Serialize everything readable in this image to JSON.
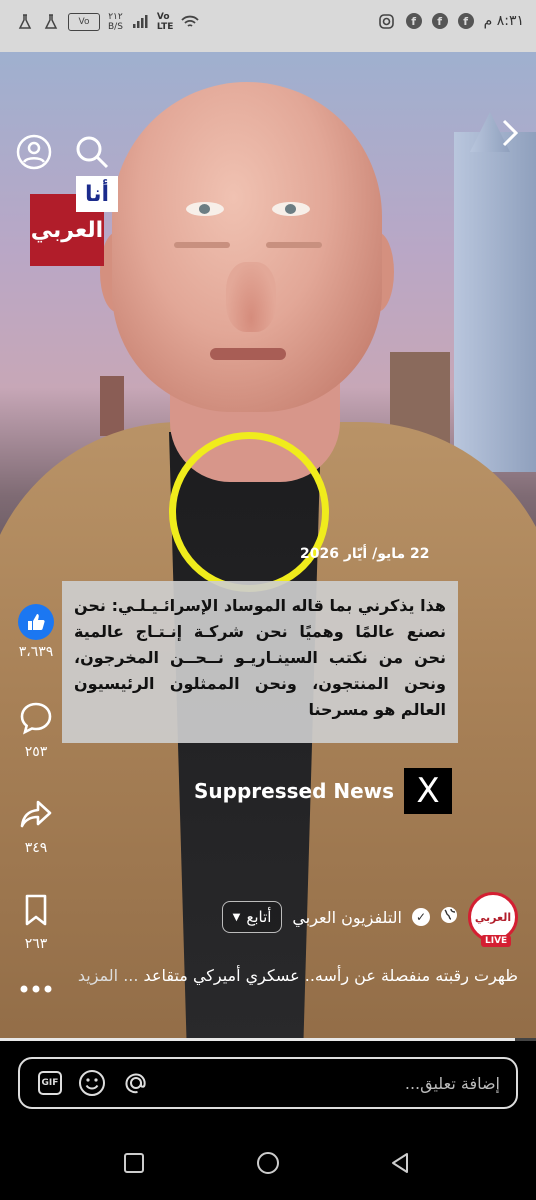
{
  "status_bar": {
    "left_icons": [
      "flask-icon",
      "flask-icon",
      "wifi-icon",
      "battery-icon"
    ],
    "battery_text": "Vo",
    "speed_top": "٢١٢",
    "speed_bottom": "B/S",
    "network_label_top": "Vo",
    "network_label_bottom": "LTE",
    "right_icons": [
      "instagram-icon",
      "facebook-icon",
      "facebook-icon",
      "facebook-icon"
    ],
    "time": "٨:٣١ م"
  },
  "video": {
    "date": "22 مايو/ أيّار 2026",
    "caption": "هذا يذكرني بما قاله الموساد الإسرائـيـلـي: نحن نصنع عالمًا وهميًا نحن شركـة إنـتـاج عالمية نحن من نكتب السينـاريـو نــحــن المخرجون، ونحن المنتجون، ونحن الممثلون الرئيسيون العالم هو مسرحنا",
    "watermark_text": "Suppressed News",
    "watermark_logo": "X",
    "channel_logo_top": "أنا",
    "channel_logo_main": "العربي",
    "annotation_color": "#f0ec1c"
  },
  "rail": {
    "likes": "٣،٦٣٩",
    "comments": "٢٥٣",
    "shares": "٣٤٩",
    "saves": "٢٦٣"
  },
  "author": {
    "name": "التلفزيون العربي",
    "follow_label": "أتابع",
    "live_badge": "LIVE",
    "avatar_text": "العربي"
  },
  "description": {
    "text": "ظهرت رقبته منفصلة عن رأسه.. عسكري أميركي متقاعد",
    "more": "... المزيد"
  },
  "progress": {
    "fraction": 0.96
  },
  "comment": {
    "placeholder": "إضافة تعليق..."
  }
}
